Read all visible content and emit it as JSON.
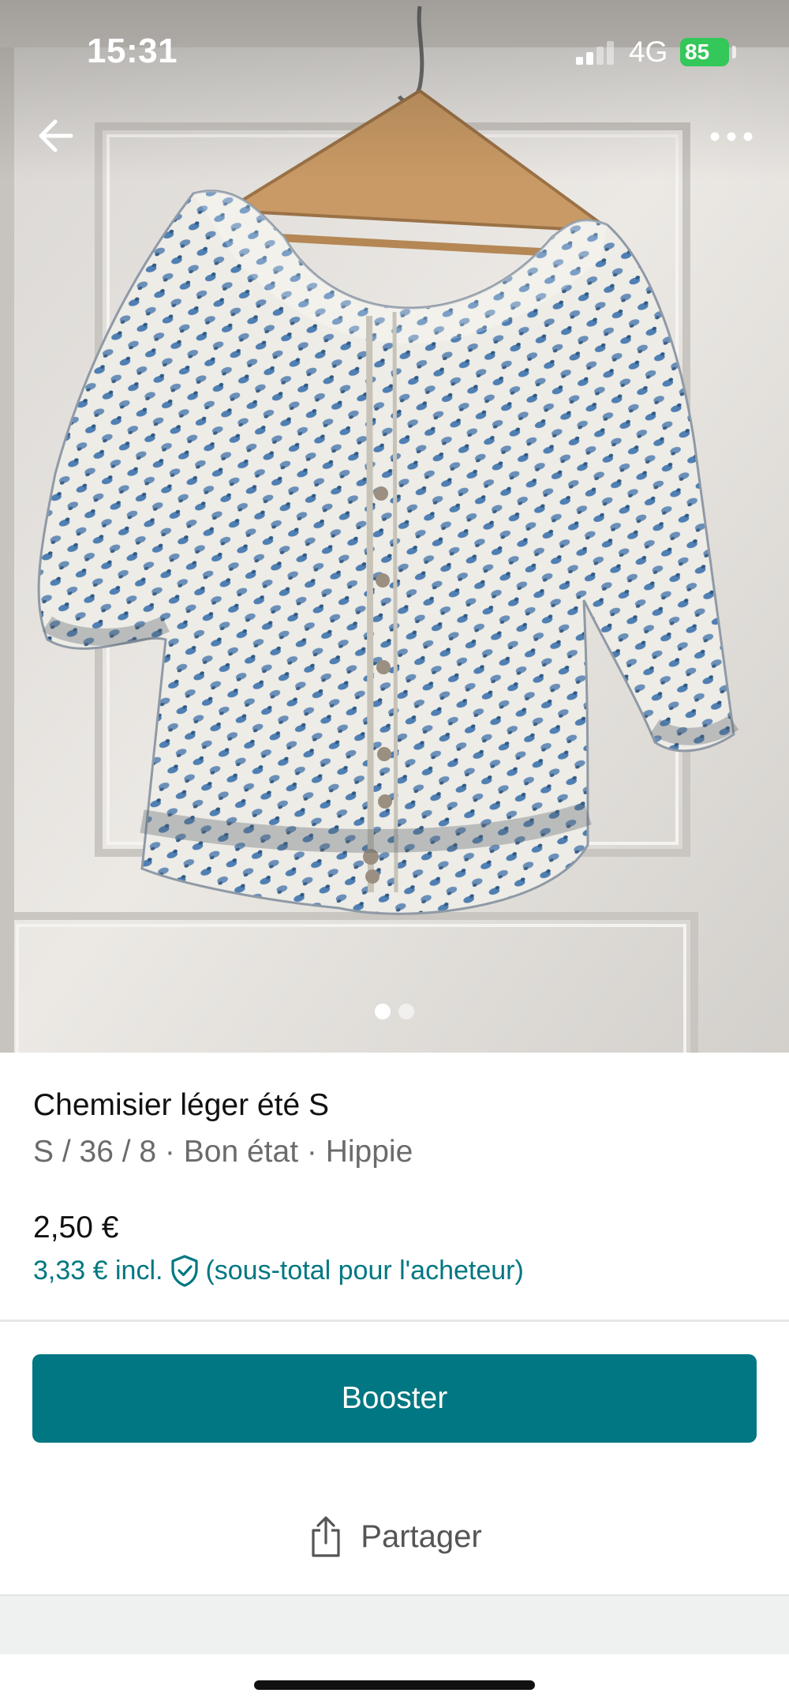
{
  "status_bar": {
    "time": "15:31",
    "network": "4G",
    "battery": "85"
  },
  "photo": {
    "description_icons": [
      "back-arrow-icon",
      "more-dots-icon"
    ],
    "page_indicator": {
      "count": 2,
      "active_index": 0
    }
  },
  "item": {
    "title": "Chemisier léger été S",
    "details": "S / 36 / 8 · Bon état · Hippie",
    "price": "2,50 €",
    "price_incl_prefix": "3,33 € incl.",
    "price_incl_suffix": "(sous-total pour l'acheteur)"
  },
  "actions": {
    "booster_label": "Booster",
    "share_label": "Partager"
  },
  "colors": {
    "accent": "#007782",
    "battery": "#34c759",
    "bottom_band": "#eff1f1"
  }
}
